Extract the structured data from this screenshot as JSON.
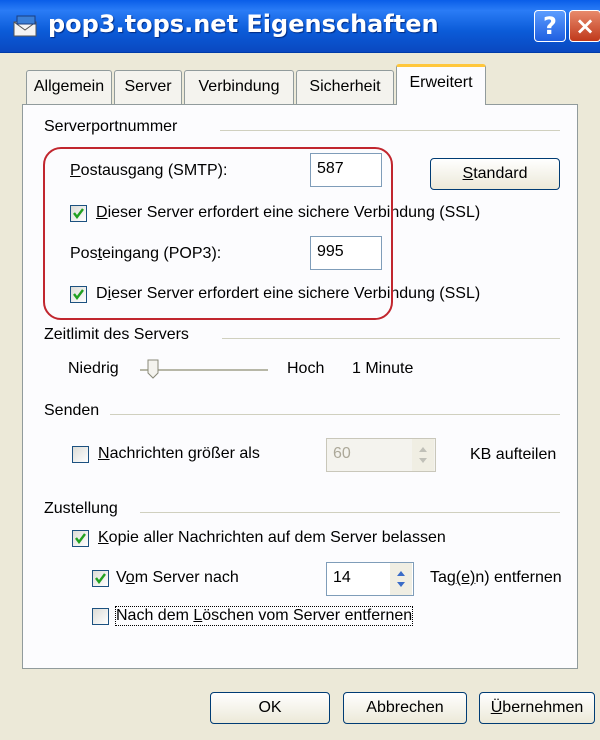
{
  "window": {
    "title": "pop3.tops.net Eigenschaften",
    "help_label": "?",
    "close_label": "×"
  },
  "tabs": [
    {
      "label": "Allgemein",
      "active": false
    },
    {
      "label": "Server",
      "active": false
    },
    {
      "label": "Verbindung",
      "active": false
    },
    {
      "label": "Sicherheit",
      "active": false
    },
    {
      "label": "Erweitert",
      "active": true
    }
  ],
  "serverports": {
    "group_label": "Serverportnummer",
    "smtp": {
      "label_pre": "",
      "label_u": "P",
      "label_post": "ostausgang (SMTP):",
      "value": "587"
    },
    "standard": {
      "label_pre": "",
      "label_u": "S",
      "label_post": "tandard"
    },
    "smtp_ssl": {
      "checked": true,
      "label_pre": "",
      "label_u": "D",
      "label_post": "ieser Server erfordert eine sichere Verbindung (SSL)"
    },
    "pop3": {
      "label_pre": "Pos",
      "label_u": "t",
      "label_post": "eingang (POP3):",
      "value": "995"
    },
    "pop3_ssl": {
      "checked": true,
      "label_pre": "D",
      "label_u": "i",
      "label_post": "eser Server erfordert eine sichere Verbindung (SSL)"
    }
  },
  "timeout": {
    "group_label": "Zeitlimit des Servers",
    "low_label": "Niedrig",
    "high_label": "Hoch",
    "value_label": "1 Minute",
    "level": 0.1
  },
  "send": {
    "group_label": "Senden",
    "split": {
      "checked": false,
      "label_pre": "",
      "label_u": "N",
      "label_post": "achrichten größer als"
    },
    "size_value": "60",
    "unit_label": "KB aufteilen"
  },
  "delivery": {
    "group_label": "Zustellung",
    "keep_copy": {
      "checked": true,
      "label_pre": "",
      "label_u": "K",
      "label_post": "opie aller Nachrichten auf dem Server belassen"
    },
    "remove_after": {
      "checked": true,
      "label_pre": "V",
      "label_u": "o",
      "label_post": "m Server nach"
    },
    "days_value": "14",
    "days_label_pre": "Tag",
    "days_label_u": "(e)",
    "days_label_post": "n) entfernen",
    "remove_deleted": {
      "checked": false,
      "label_pre": "Nach dem ",
      "label_u": "L",
      "label_post": "öschen vom Server entfernen"
    }
  },
  "buttons": {
    "ok": "OK",
    "cancel": "Abbrechen",
    "apply_u": "Ü",
    "apply_post": "bernehmen"
  },
  "colors": {
    "accent": "#0a5ee8",
    "highlight_ring": "#c1262e",
    "check": "#21a121"
  }
}
